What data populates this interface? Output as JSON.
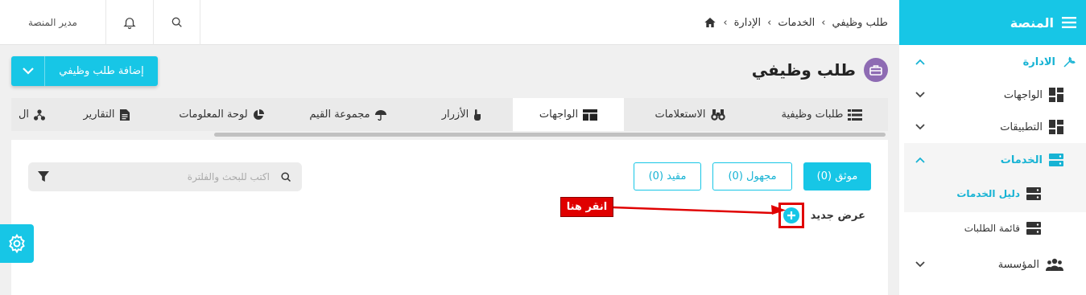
{
  "topbar": {
    "user_label": "مدير المنصة",
    "breadcrumb": [
      "الإدارة",
      "الخدمات",
      "طلب وظيفي"
    ]
  },
  "sidebar": {
    "title": "المنصة",
    "items": [
      {
        "label": "الادارة",
        "icon": "wrench-icon",
        "level": 1,
        "expanded": true
      },
      {
        "label": "الواجهات",
        "icon": "dashboard-icon",
        "level": 2,
        "expanded": false
      },
      {
        "label": "التطبيقات",
        "icon": "dashboard-icon",
        "level": 2,
        "expanded": false
      },
      {
        "label": "الخدمات",
        "icon": "server-icon",
        "level": 2,
        "expanded": true,
        "active": true
      },
      {
        "label": "دليل الخدمات",
        "icon": "server-icon",
        "level": 3,
        "active": true
      },
      {
        "label": "قائمة الطلبات",
        "icon": "server-icon",
        "level": 3
      },
      {
        "label": "المؤسسة",
        "icon": "users-icon",
        "level": 2,
        "expanded": false
      }
    ]
  },
  "page": {
    "title": "طلب وظيفي",
    "add_button_label": "إضافة طلب وظيفي"
  },
  "tabs": [
    {
      "label": "طلبات وظيفية",
      "icon": "list-icon"
    },
    {
      "label": "الاستعلامات",
      "icon": "binoculars-icon"
    },
    {
      "label": "الواجهات",
      "icon": "window-icon",
      "active": true
    },
    {
      "label": "الأزرار",
      "icon": "pointer-icon"
    },
    {
      "label": "مجموعة القيم",
      "icon": "umbrella-icon"
    },
    {
      "label": "لوحة المعلومات",
      "icon": "pie-icon"
    },
    {
      "label": "التقارير",
      "icon": "file-icon"
    },
    {
      "label": "ال",
      "icon": "sitemap-icon"
    }
  ],
  "filters": [
    {
      "label": "موثق (0)",
      "active": true
    },
    {
      "label": "مجهول (0)"
    },
    {
      "label": "مقيد (0)"
    }
  ],
  "search": {
    "placeholder": "اكتب للبحث والفلترة",
    "value": ""
  },
  "new_view_label": "عرض جديد",
  "callout_label": "انقر هنا",
  "colors": {
    "accent": "#17c6e6",
    "callout": "#e00000",
    "title_badge": "#8e6bb3"
  }
}
